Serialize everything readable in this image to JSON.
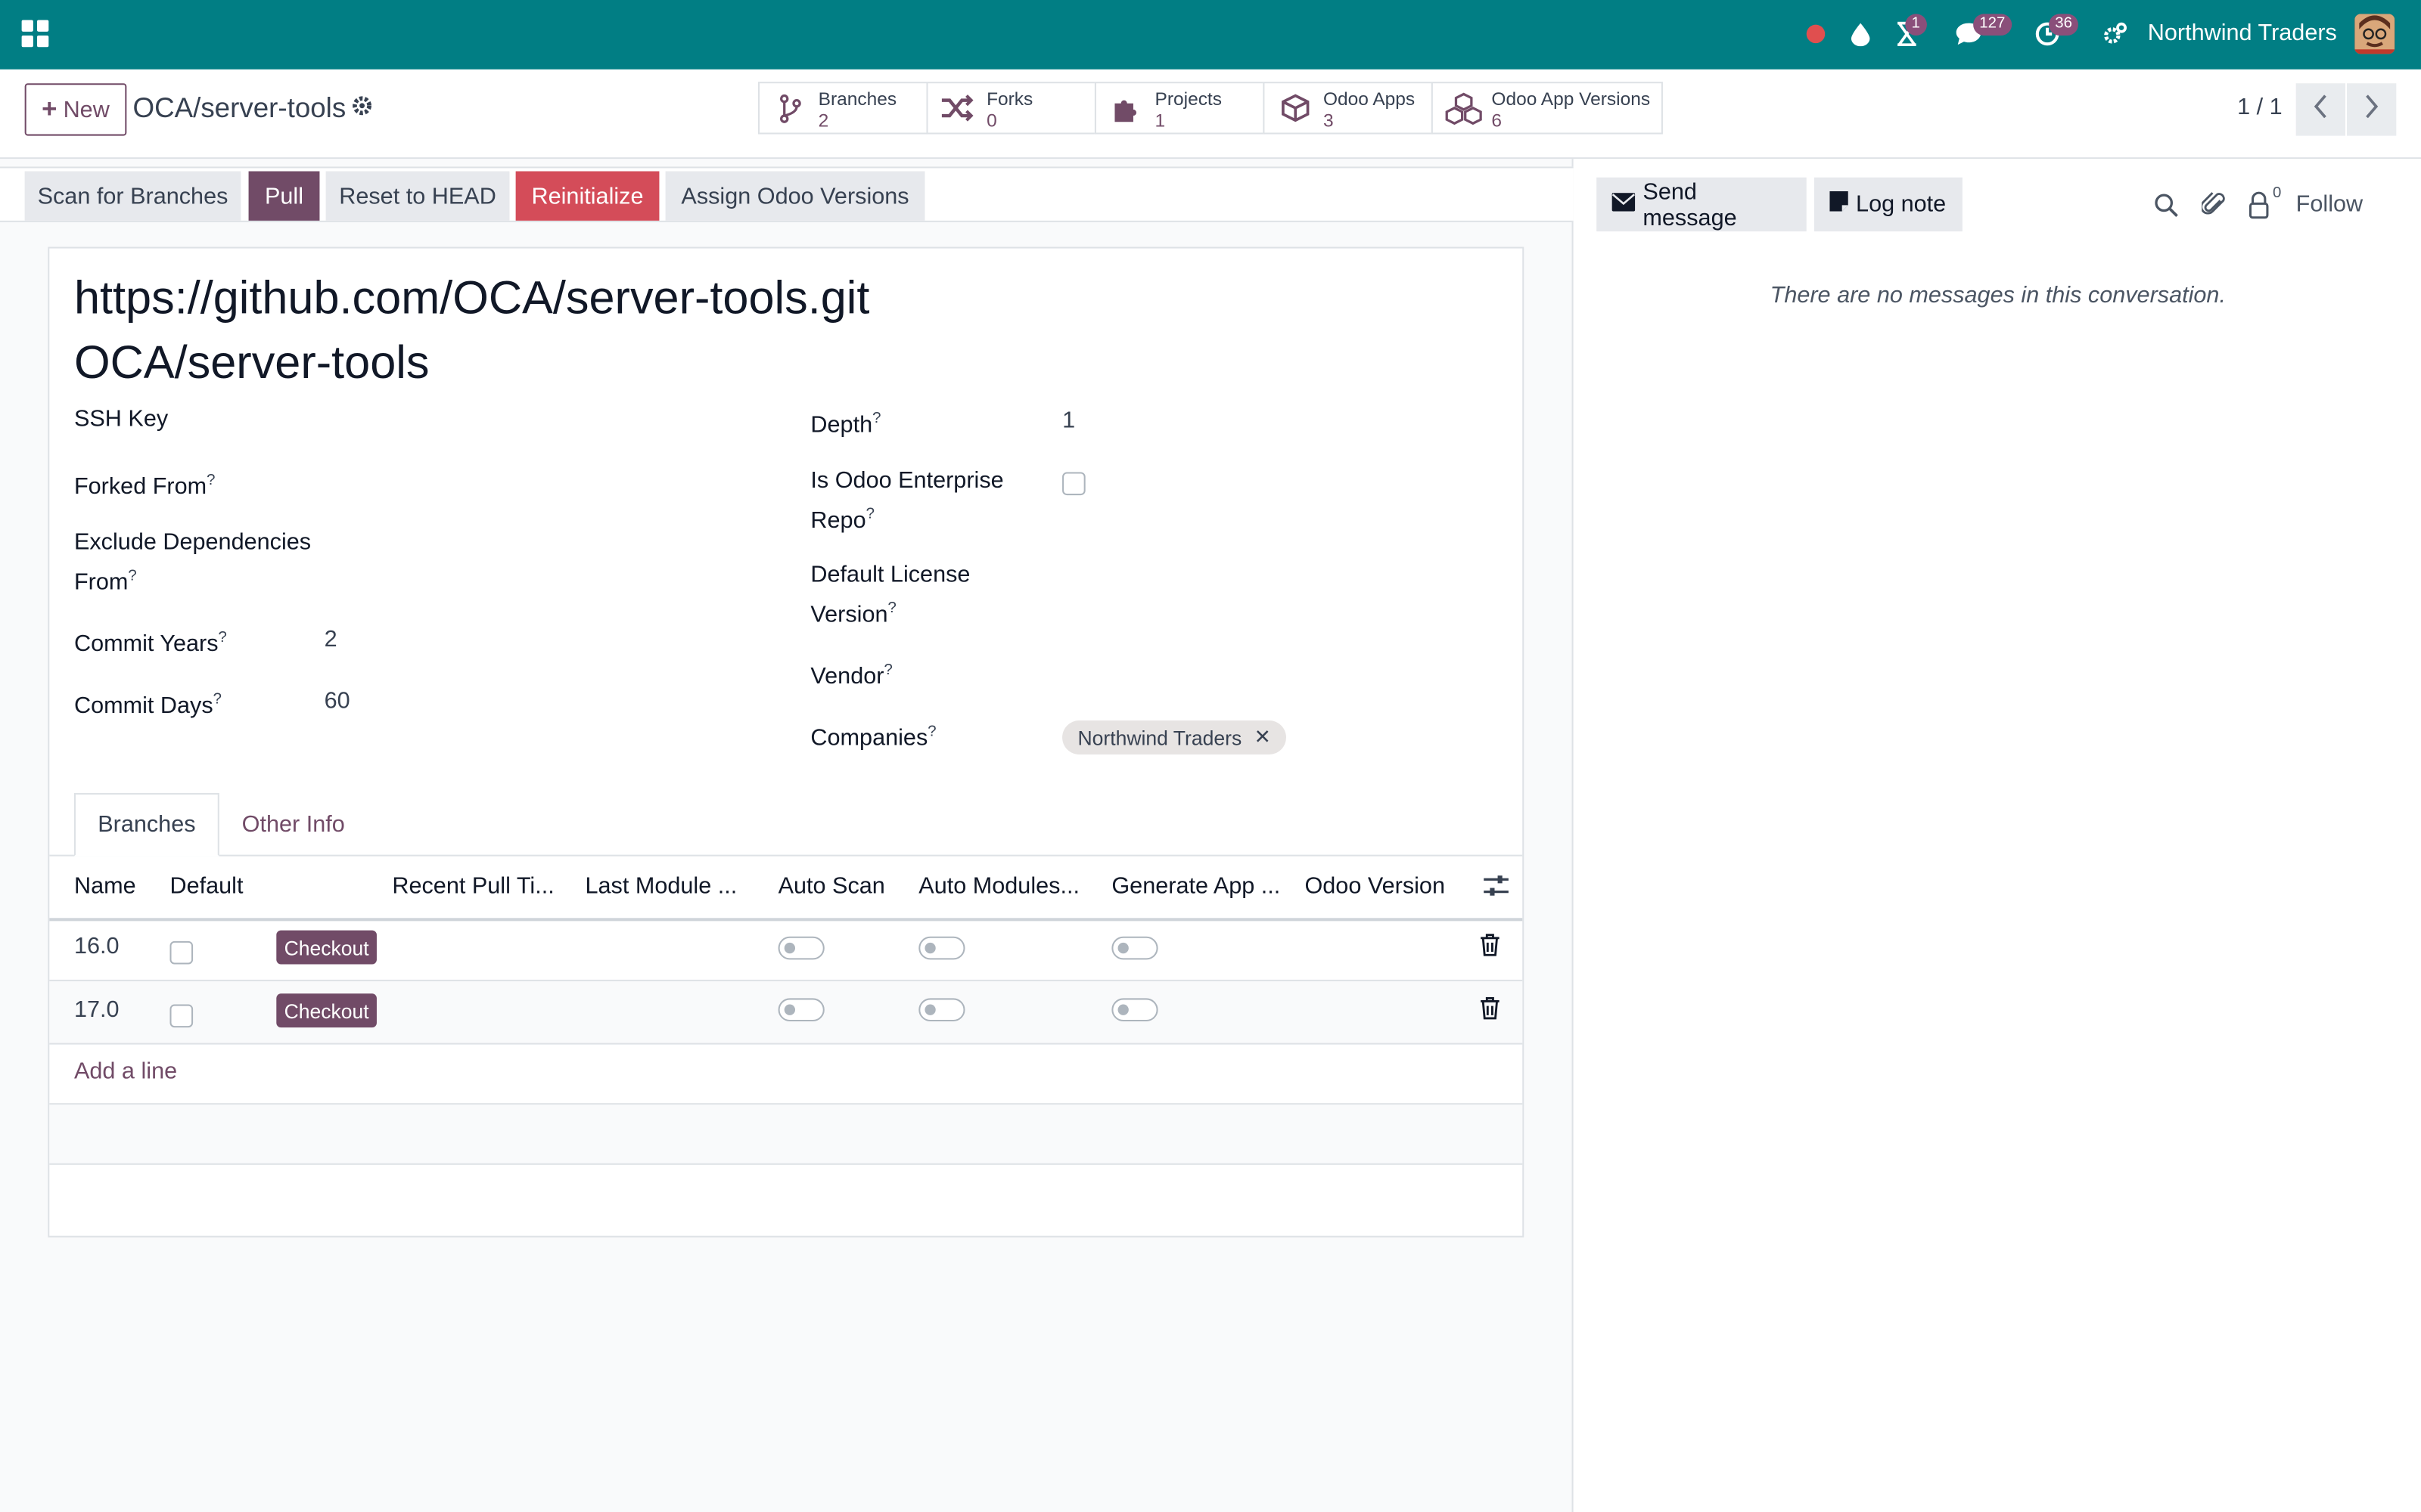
{
  "navbar": {
    "company": "Northwind Traders",
    "badges": {
      "activities_clock": "1",
      "messages": "127",
      "tasks": "36"
    },
    "icons": [
      "apps-grid-icon",
      "record-dot-icon",
      "droplet-icon",
      "hourglass-icon",
      "chat-icon",
      "clock-icon",
      "settings-icon"
    ],
    "color": "#017e84"
  },
  "control_panel": {
    "new_label": "New",
    "record_title": "OCA/server-tools",
    "pager": "1 / 1",
    "smart_buttons": [
      {
        "label": "Branches",
        "value": "2",
        "icon": "branch-icon"
      },
      {
        "label": "Forks",
        "value": "0",
        "icon": "shuffle-icon"
      },
      {
        "label": "Projects",
        "value": "1",
        "icon": "puzzle-icon"
      },
      {
        "label": "Odoo Apps",
        "value": "3",
        "icon": "cube-icon"
      },
      {
        "label": "Odoo App Versions",
        "value": "6",
        "icon": "cubes-icon"
      }
    ]
  },
  "header_buttons": {
    "scan": "Scan for Branches",
    "pull": "Pull",
    "reset": "Reset to HEAD",
    "reinit": "Reinitialize",
    "assign": "Assign Odoo Versions"
  },
  "form": {
    "url": "https://github.com/OCA/server-tools.git",
    "name": "OCA/server-tools",
    "left_fields": {
      "ssh_key": "SSH Key",
      "forked_from": "Forked From",
      "exclude_line1": "Exclude Dependencies",
      "exclude_line2": "From",
      "commit_years": "Commit Years",
      "commit_years_val": "2",
      "commit_days": "Commit Days",
      "commit_days_val": "60"
    },
    "right_fields": {
      "depth": "Depth",
      "depth_val": "1",
      "enterprise_line1": "Is Odoo Enterprise",
      "enterprise_line2": "Repo",
      "license_line1": "Default License",
      "license_line2": "Version",
      "vendor": "Vendor",
      "companies": "Companies",
      "company_tag": "Northwind Traders"
    },
    "help_mark": "?"
  },
  "tabs": [
    "Branches",
    "Other Info"
  ],
  "table": {
    "columns": [
      "Name",
      "Default",
      "Recent Pull Ti...",
      "Last Module ...",
      "Auto Scan",
      "Auto Modules...",
      "Generate App ...",
      "Odoo Version"
    ],
    "rows": [
      {
        "name": "16.0",
        "button": "Checkout",
        "default": false,
        "auto_scan": false,
        "auto_modules": false,
        "generate_app": false
      },
      {
        "name": "17.0",
        "button": "Checkout",
        "default": false,
        "auto_scan": false,
        "auto_modules": false,
        "generate_app": false
      }
    ],
    "add_line": "Add a line"
  },
  "chatter": {
    "send_message": "Send message",
    "log_note": "Log note",
    "follower_count": "0",
    "follow": "Follow",
    "empty": "There are no messages in this conversation."
  }
}
